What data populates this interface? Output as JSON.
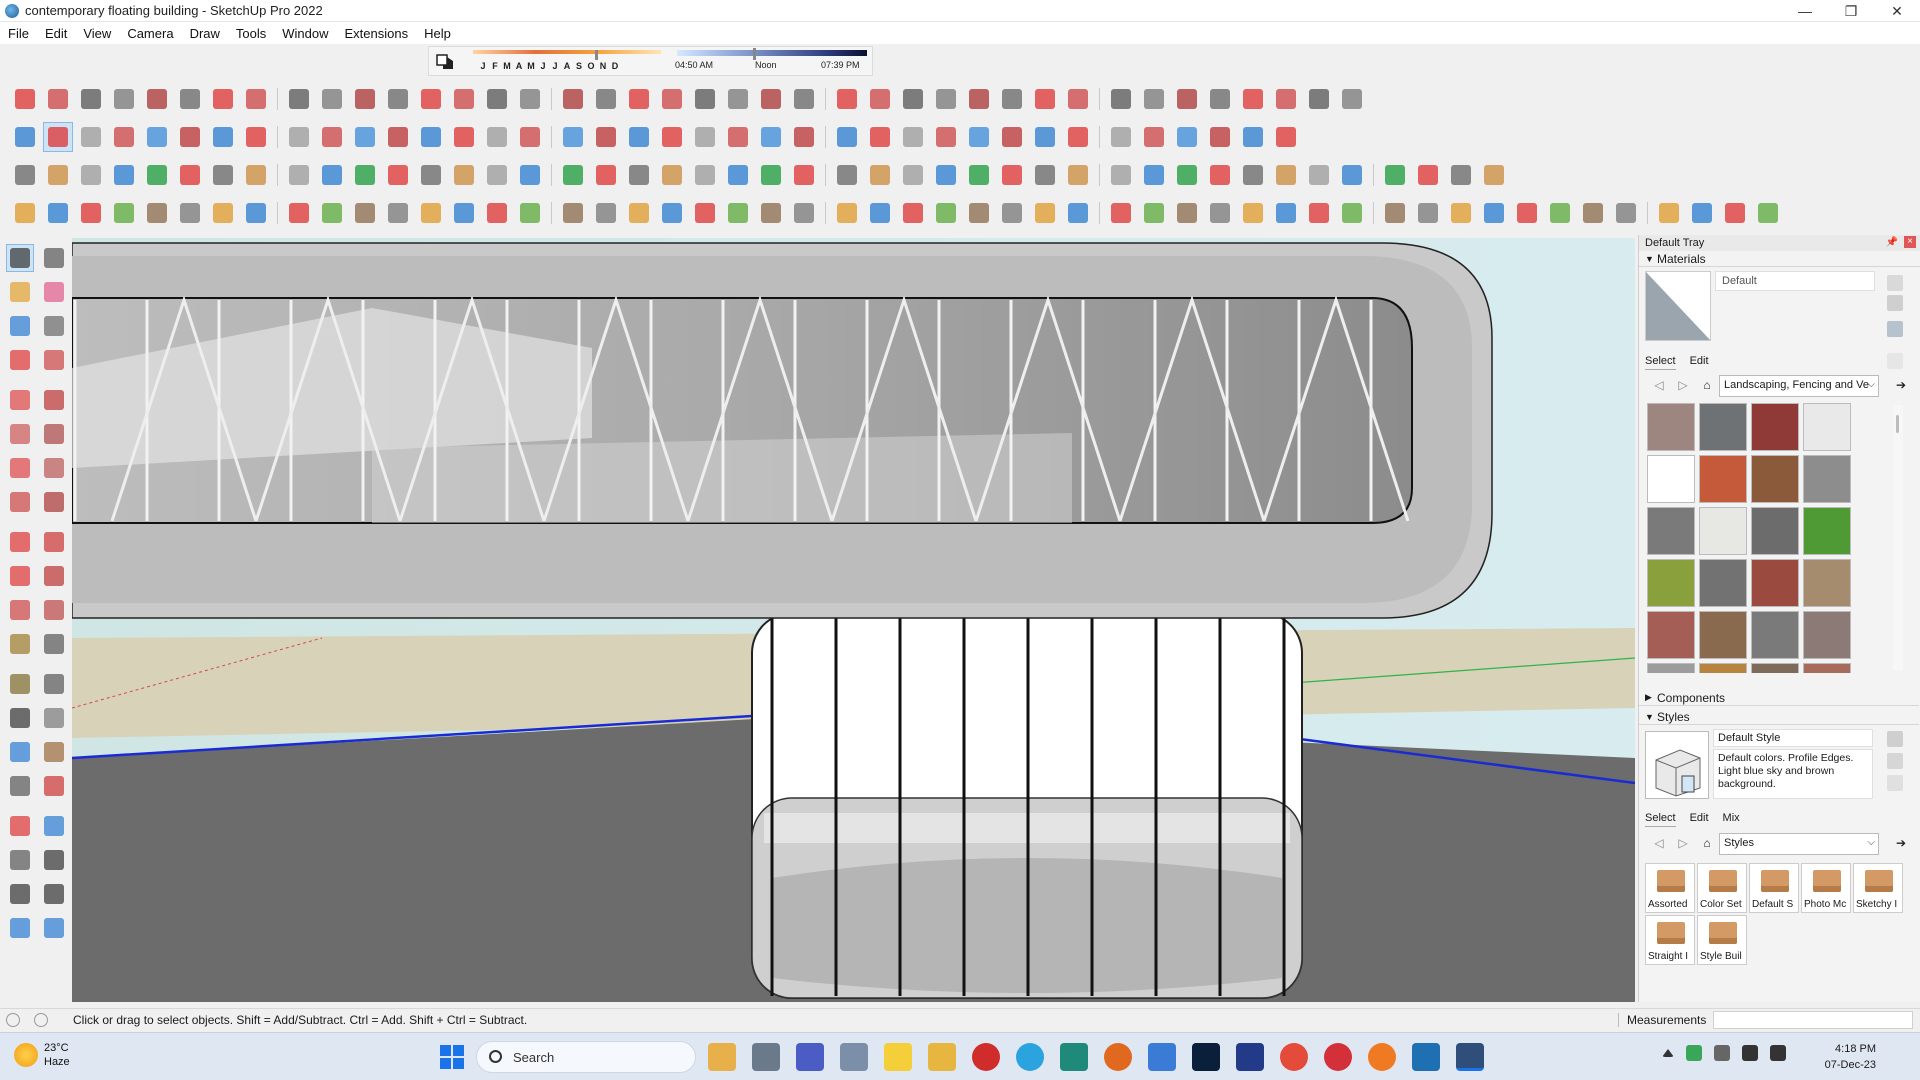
{
  "window": {
    "title": "contemporary floating building - SketchUp Pro 2022",
    "controls": [
      "—",
      "❐",
      "✕"
    ]
  },
  "menu": [
    "File",
    "Edit",
    "View",
    "Camera",
    "Draw",
    "Tools",
    "Window",
    "Extensions",
    "Help"
  ],
  "shadows": {
    "months": [
      "J",
      "F",
      "M",
      "A",
      "M",
      "J",
      "J",
      "A",
      "S",
      "O",
      "N",
      "D"
    ],
    "time_start": "04:50 AM",
    "time_mid": "Noon",
    "time_end": "07:39 PM"
  },
  "tray": {
    "title": "Default Tray",
    "materials": {
      "header": "Materials",
      "current_name": "Default",
      "tabs": [
        "Select",
        "Edit"
      ],
      "library": "Landscaping, Fencing and Ve",
      "swatch_colors": [
        "#9d8580",
        "#6f7275",
        "#8f3a36",
        "#e9e9e9",
        "#ffffff",
        "#c55a3a",
        "#8a5a3a",
        "#8d8d8d",
        "#7a7a7a",
        "#e7e7e4",
        "#6c6c6c",
        "#4f9a34",
        "#8aa03c",
        "#727272",
        "#9b4a40",
        "#a58c6f",
        "#a55e56",
        "#8a6a4f",
        "#7a7a7a",
        "#8b7a76",
        "#9c9c9c",
        "#b7843f",
        "#7e6a58",
        "#a86a5a"
      ]
    },
    "components": {
      "header": "Components"
    },
    "styles": {
      "header": "Styles",
      "current_name": "Default Style",
      "description": "Default colors. Profile Edges. Light blue sky and brown background.",
      "tabs": [
        "Select",
        "Edit",
        "Mix"
      ],
      "library": "Styles",
      "collections": [
        "Assorted",
        "Color Set",
        "Default S",
        "Photo Mc",
        "Sketchy I",
        "Straight I",
        "Style Buil"
      ]
    }
  },
  "status": {
    "hint": "Click or drag to select objects. Shift = Add/Subtract. Ctrl = Add. Shift + Ctrl = Subtract.",
    "measurements_label": "Measurements",
    "measurements_value": ""
  },
  "taskbar": {
    "temperature": "23°C",
    "condition": "Haze",
    "search_placeholder": "Search",
    "time": "4:18 PM",
    "date": "07-Dec-23"
  },
  "colors": {
    "accent": "#1a73e8",
    "sky": "#d9ebe9",
    "ground": "#6b6b6b",
    "axis_blue": "#1b2bd4",
    "axis_green": "#2fb34a",
    "axis_red": "#d14a4a"
  }
}
